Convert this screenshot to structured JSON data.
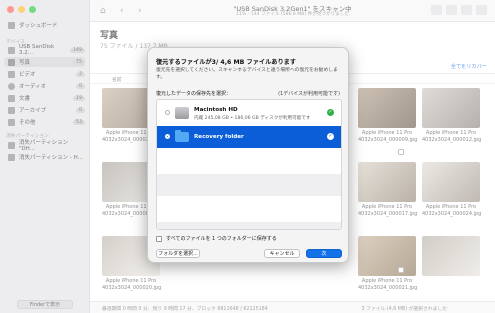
{
  "toolbar": {
    "title": "\"USB  SanDisk 3.2Gen1\" をスキャン中",
    "subtitle": "11% - 144 ファイル (586.8 MB) 件が見つかりました"
  },
  "sidebar": {
    "dashboard": "ダッシュボード",
    "section_device": "デバイス",
    "device": {
      "label": "USB  SanDisk 3.2...",
      "count": "149"
    },
    "items": [
      {
        "label": "写真",
        "count": "75"
      },
      {
        "label": "ビデオ",
        "count": "2"
      },
      {
        "label": "オーディオ",
        "count": "0"
      },
      {
        "label": "文書",
        "count": "19"
      },
      {
        "label": "アーカイブ",
        "count": "0"
      },
      {
        "label": "その他",
        "count": "53"
      }
    ],
    "section_lost": "消失パーティション",
    "lost": [
      "消失パーティション \"DH...",
      "消失パーティション - H..."
    ],
    "finder_button": "Finderで表示"
  },
  "content": {
    "title": "写真",
    "subtitle": "75 ファイル / 137.7 MB",
    "view_label": "表示",
    "recover_all": "全てをリカバー",
    "col_name": "名前",
    "status_text": "最適期間 0 時間 0 分、残り 9 時間 17 分、ブロック 6811648 / 62125184",
    "status_right": "3 ファイル (4,6 MB) が選択されました",
    "thumbs": [
      {
        "cap1": "Apple iPhone 11 Pro",
        "cap2": "4032x3024_000028.jpg"
      },
      {
        "cap1": "Apple iPhone 11 Pro",
        "cap2": "4032x3024_000009.jpg"
      },
      {
        "cap1": "Apple iPhone 11 Pro",
        "cap2": "4032x3024_000020.jpg"
      },
      {
        "cap1": "Apple iPhone 11 Pro",
        "cap2": "4032x3024_000009.jpg"
      },
      {
        "cap1": "Apple iPhone 11 Pro",
        "cap2": "4032x3024_000017.jpg"
      },
      {
        "cap1": "Apple iPhone 11 Pro",
        "cap2": "4032x3024_000021.jpg"
      },
      {
        "cap1": "Apple iPhone 11 Pro",
        "cap2": "4032x3024_000012.jpg"
      },
      {
        "cap1": "Apple iPhone 11 Pro",
        "cap2": "4032x3024_000024.jpg"
      }
    ]
  },
  "modal": {
    "title": "復元するファイルが3/ 4,6 MB ファイルあります",
    "description": "復元先を選択してください。スキャンするデバイスと違う場所への復元をお勧めします。",
    "choose_label": "復元したデータの保存先を選択：",
    "available_info": "(1デバイスが利用可能です)",
    "destinations": [
      {
        "name": "Macintosh HD",
        "sub": "内蔵 245,08 GB • 186,06 GB ディスクが利用可能です"
      },
      {
        "name": "Recovery folder",
        "sub": ""
      }
    ],
    "checkbox_label": "すべてのファイルを 1 つのフォルダーに保存する",
    "select_folder_button": "フォルダを選択...",
    "cancel_button": "キャンセル",
    "next_button": "次"
  }
}
